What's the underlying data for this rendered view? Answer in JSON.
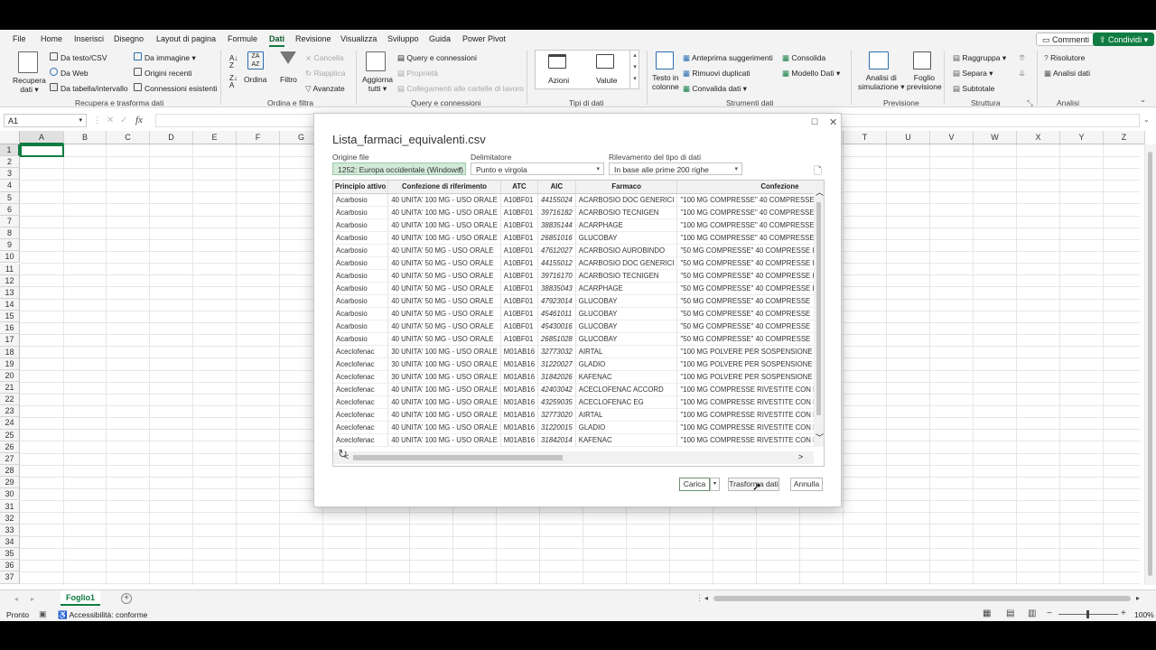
{
  "menu": {
    "items": [
      "File",
      "Home",
      "Inserisci",
      "Disegno",
      "Layout di pagina",
      "Formule",
      "Dati",
      "Revisione",
      "Visualizza",
      "Sviluppo",
      "Guida",
      "Power Pivot"
    ],
    "active": "Dati",
    "comments": "Commenti",
    "share": "Condividi"
  },
  "ribbon": {
    "get_data": "Recupera dati",
    "get_data_line1": "Recupera",
    "get_data_line2": "dati",
    "from_text": "Da testo/CSV",
    "from_web": "Da Web",
    "from_table": "Da tabella/intervallo",
    "from_image": "Da immagine",
    "recent_sources": "Origini recenti",
    "existing_conn": "Connessioni esistenti",
    "group_get": "Recupera e trasforma dati",
    "sort": "Ordina",
    "filter": "Filtro",
    "clear": "Cancella",
    "reapply": "Riapplica",
    "advanced": "Avanzate",
    "group_sort": "Ordina e filtra",
    "refresh_line1": "Aggiorna",
    "refresh_line2": "tutti",
    "queries_conn": "Query e connessioni",
    "properties": "Proprietà",
    "workbook_links": "Collegamenti alle cartelle di lavoro",
    "group_queries": "Query e connessioni",
    "stocks": "Azioni",
    "currencies": "Valute",
    "group_types": "Tipi di dati",
    "text_to_cols_1": "Testo in",
    "text_to_cols_2": "colonne",
    "flash_fill": "Anteprima suggerimenti",
    "remove_dup": "Rimuovi duplicati",
    "validation": "Convalida dati",
    "consolidate": "Consolida",
    "data_model": "Modello Dati",
    "group_tools": "Strumenti dati",
    "whatif_1": "Analisi di",
    "whatif_2": "simulazione",
    "forecast_1": "Foglio",
    "forecast_2": "previsione",
    "group_forecast": "Previsione",
    "group_btn": "Raggruppa",
    "ungroup": "Separa",
    "subtotal": "Subtotale",
    "group_outline": "Struttura",
    "solver": "Risolutore",
    "analyze": "Analisi dati",
    "group_analysis": "Analisi"
  },
  "formula_bar": {
    "name_box": "A1",
    "fx": "fx",
    "value": ""
  },
  "grid": {
    "columns": [
      "A",
      "B",
      "C",
      "D",
      "E",
      "F",
      "G",
      "H",
      "I",
      "J",
      "K",
      "L",
      "M",
      "N",
      "O",
      "P",
      "Q",
      "R",
      "S",
      "T",
      "U",
      "V",
      "W",
      "X",
      "Y",
      "Z"
    ],
    "rows": [
      "1",
      "2",
      "3",
      "4",
      "5",
      "6",
      "7",
      "8",
      "9",
      "10",
      "11",
      "12",
      "13",
      "14",
      "15",
      "16",
      "17",
      "18",
      "19",
      "20",
      "21",
      "22",
      "23",
      "24",
      "25",
      "26",
      "27",
      "28",
      "29",
      "30",
      "31",
      "32",
      "33",
      "34",
      "35",
      "36",
      "37"
    ],
    "selected_cell": "A1"
  },
  "sheet": {
    "tab": "Foglio1",
    "add_label": "+"
  },
  "status": {
    "ready": "Pronto",
    "accessibility": "Accessibilità: conforme",
    "zoom": "100%"
  },
  "dialog": {
    "title": "Lista_farmaci_equivalenti.csv",
    "origin_label": "Origine file",
    "origin_value": "1252: Europa occidentale (Windows)",
    "delimiter_label": "Delimitatore",
    "delimiter_value": "Punto e virgola",
    "detect_label": "Rilevamento del tipo di dati",
    "detect_value": "In base alle prime 200 righe",
    "columns": [
      "Principio attivo",
      "Confezione di riferimento",
      "ATC",
      "AIC",
      "Farmaco",
      "Confezione"
    ],
    "rows": [
      [
        "Acarbosio",
        "40 UNITA' 100 MG - USO ORALE",
        "A10BF01",
        "44155024",
        "ACARBOSIO DOC GENERICI",
        "\"100 MG COMPRESSE\" 40 COMPRESSE IN BLISTER PVC/..."
      ],
      [
        "Acarbosio",
        "40 UNITA' 100 MG - USO ORALE",
        "A10BF01",
        "39716182",
        "ACARBOSIO TECNIGEN",
        "\"100 MG COMPRESSE\" 40 COMPRESSE IN BLISTER PVC/..."
      ],
      [
        "Acarbosio",
        "40 UNITA' 100 MG - USO ORALE",
        "A10BF01",
        "38835144",
        "ACARPHAGE",
        "\"100 MG COMPRESSE\" 40 COMPRESSE IN BLISTER AL/AL"
      ],
      [
        "Acarbosio",
        "40 UNITA' 100 MG - USO ORALE",
        "A10BF01",
        "26851016",
        "GLUCOBAY",
        "\"100 MG COMPRESSE\" 40 COMPRESSE"
      ],
      [
        "Acarbosio",
        "40 UNITA' 50 MG - USO ORALE",
        "A10BF01",
        "47612027",
        "ACARBOSIO AUROBINDO",
        "\"50 MG COMPRESSE\" 40 COMPRESSE IN BLISTER PVC/P..."
      ],
      [
        "Acarbosio",
        "40 UNITA' 50 MG - USO ORALE",
        "A10BF01",
        "44155012",
        "ACARBOSIO DOC GENERICI",
        "\"50 MG COMPRESSE\" 40 COMPRESSE IN BLISTER PVC/P..."
      ],
      [
        "Acarbosio",
        "40 UNITA' 50 MG - USO ORALE",
        "A10BF01",
        "39716170",
        "ACARBOSIO TECNIGEN",
        "\"50 MG COMPRESSE\" 40 COMPRESSE IN BLISTER PVC/P..."
      ],
      [
        "Acarbosio",
        "40 UNITA' 50 MG - USO ORALE",
        "A10BF01",
        "38835043",
        "ACARPHAGE",
        "\"50 MG COMPRESSE\" 40 COMPRESSE IN BLISTER AL/AL"
      ],
      [
        "Acarbosio",
        "40 UNITA' 50 MG - USO ORALE",
        "A10BF01",
        "47923014",
        "GLUCOBAY",
        "\"50 MG COMPRESSE\" 40 COMPRESSE"
      ],
      [
        "Acarbosio",
        "40 UNITA' 50 MG - USO ORALE",
        "A10BF01",
        "45461011",
        "GLUCOBAY",
        "\"50 MG COMPRESSE\" 40 COMPRESSE"
      ],
      [
        "Acarbosio",
        "40 UNITA' 50 MG - USO ORALE",
        "A10BF01",
        "45430016",
        "GLUCOBAY",
        "\"50 MG COMPRESSE\" 40 COMPRESSE"
      ],
      [
        "Acarbosio",
        "40 UNITA' 50 MG - USO ORALE",
        "A10BF01",
        "26851028",
        "GLUCOBAY",
        "\"50 MG COMPRESSE\" 40 COMPRESSE"
      ],
      [
        "Aceclofenac",
        "30 UNITA' 100 MG - USO ORALE",
        "M01AB16",
        "32773032",
        "AIRTAL",
        "\"100 MG POLVERE PER SOSPENSIONE ORALE\" 30 BUSTI..."
      ],
      [
        "Aceclofenac",
        "30 UNITA' 100 MG - USO ORALE",
        "M01AB16",
        "31220027",
        "GLADIO",
        "\"100 MG POLVERE PER SOSPENSIONE ORALE\"30 BUSTI..."
      ],
      [
        "Aceclofenac",
        "30 UNITA' 100 MG - USO ORALE",
        "M01AB16",
        "31842026",
        "KAFENAC",
        "\"100 MG POLVERE PER SOSPENSIONE ORALE\" 30 BUSTI..."
      ],
      [
        "Aceclofenac",
        "40 UNITA' 100 MG - USO ORALE",
        "M01AB16",
        "42403042",
        "ACECLOFENAC ACCORD",
        "\"100 MG COMPRESSE RIVESTITE CON FILM\" 40 COMPR..."
      ],
      [
        "Aceclofenac",
        "40 UNITA' 100 MG - USO ORALE",
        "M01AB16",
        "43259035",
        "ACECLOFENAC EG",
        "\"100 MG COMPRESSE RIVESTITE CON FILM\" 40 COMPR..."
      ],
      [
        "Aceclofenac",
        "40 UNITA' 100 MG - USO ORALE",
        "M01AB16",
        "32773020",
        "AIRTAL",
        "\"100 MG COMPRESSE RIVESTITE CON FILM\" 40 COMPR..."
      ],
      [
        "Aceclofenac",
        "40 UNITA' 100 MG - USO ORALE",
        "M01AB16",
        "31220015",
        "GLADIO",
        "\"100 MG COMPRESSE RIVESTITE CON FILM\" 40 COMPR..."
      ],
      [
        "Aceclofenac",
        "40 UNITA' 100 MG - USO ORALE",
        "M01AB16",
        "31842014",
        "KAFENAC",
        "\"100 MG COMPRESSE RIVESTITE CON FILM\" 40 COMPR..."
      ]
    ],
    "load": "Carica",
    "transform": "Trasforma dati",
    "cancel": "Annulla"
  },
  "colors": {
    "excel_green": "#107c41",
    "selected_option": "#d3ead8"
  }
}
